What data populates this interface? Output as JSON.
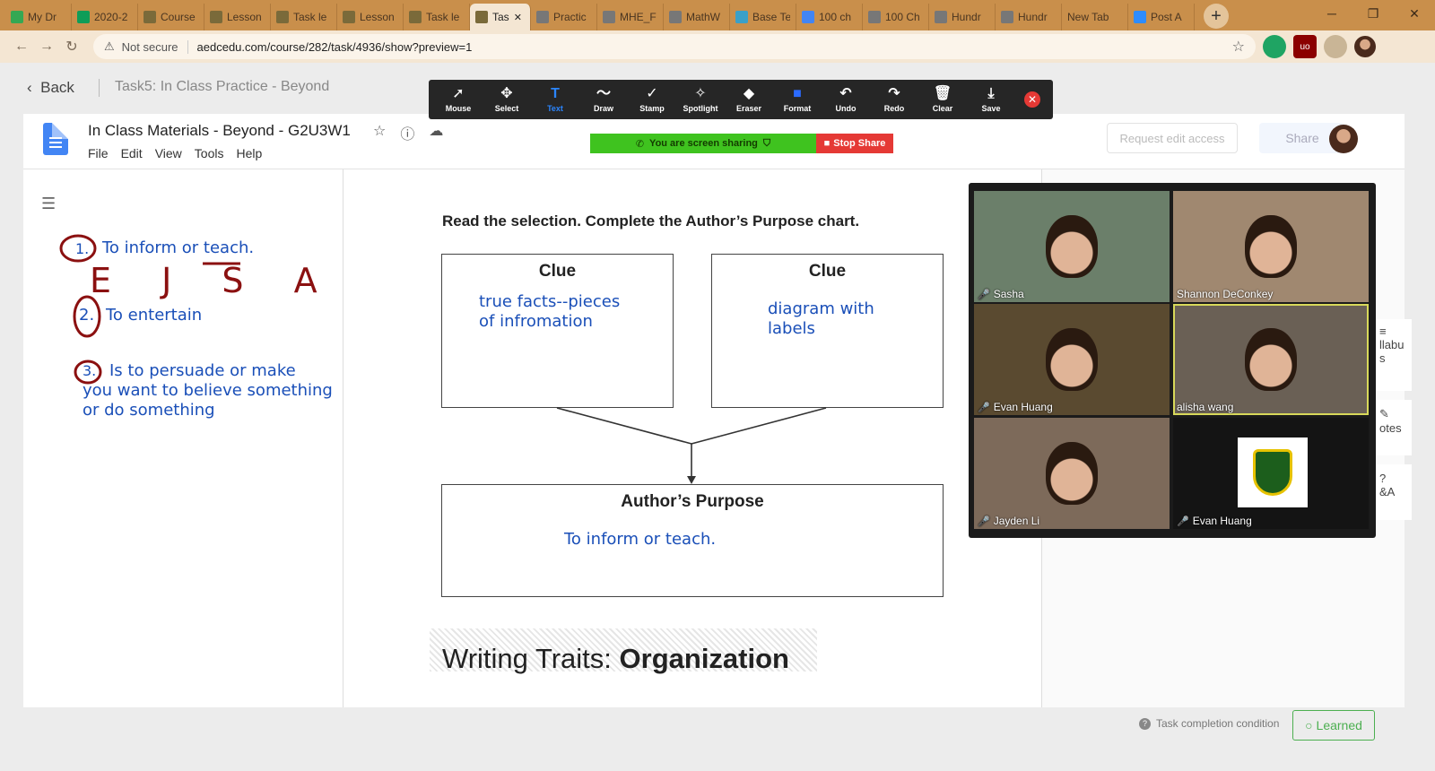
{
  "browser": {
    "tabs": [
      {
        "label": "My Dr",
        "color": "#34a853"
      },
      {
        "label": "2020-2",
        "color": "#0f9d58"
      },
      {
        "label": "Course",
        "color": "#7a6a3a"
      },
      {
        "label": "Lesson",
        "color": "#7a6a3a"
      },
      {
        "label": "Task le",
        "color": "#7a6a3a"
      },
      {
        "label": "Lesson",
        "color": "#7a6a3a"
      },
      {
        "label": "Task le",
        "color": "#7a6a3a"
      },
      {
        "label": "Tas",
        "color": "#7a6a3a",
        "active": true
      },
      {
        "label": "Practic",
        "color": "#777"
      },
      {
        "label": "MHE_F",
        "color": "#777"
      },
      {
        "label": "MathW",
        "color": "#777"
      },
      {
        "label": "Base Te",
        "color": "#3aa0c8"
      },
      {
        "label": "100 ch",
        "color": "#4285f4"
      },
      {
        "label": "100 Ch",
        "color": "#777"
      },
      {
        "label": "Hundr",
        "color": "#777"
      },
      {
        "label": "Hundr",
        "color": "#777"
      },
      {
        "label": "New Tab",
        "color": ""
      },
      {
        "label": "Post A",
        "color": "#2d8cff"
      }
    ],
    "address": {
      "security": "Not secure",
      "url": "aedcedu.com/course/282/task/4936/show?preview=1"
    }
  },
  "page": {
    "back_label": "Back",
    "breadcrumb": "Task5:  In Class Practice - Beyond"
  },
  "annotate_toolbar": {
    "tools": [
      {
        "name": "mouse",
        "label": "Mouse",
        "icon": "➚"
      },
      {
        "name": "select",
        "label": "Select",
        "icon": "✥"
      },
      {
        "name": "text",
        "label": "Text",
        "icon": "T",
        "selected": true
      },
      {
        "name": "draw",
        "label": "Draw",
        "icon": "〜"
      },
      {
        "name": "stamp",
        "label": "Stamp",
        "icon": "✓"
      },
      {
        "name": "spotlight",
        "label": "Spotlight",
        "icon": "✧"
      },
      {
        "name": "eraser",
        "label": "Eraser",
        "icon": "◆"
      },
      {
        "name": "format",
        "label": "Format",
        "icon": "■"
      },
      {
        "name": "undo",
        "label": "Undo",
        "icon": "↶"
      },
      {
        "name": "redo",
        "label": "Redo",
        "icon": "↷"
      },
      {
        "name": "clear",
        "label": "Clear",
        "icon": "🗑"
      },
      {
        "name": "save",
        "label": "Save",
        "icon": "⤓"
      }
    ]
  },
  "doc": {
    "title": "In Class Materials - Beyond - G2U3W1",
    "menu": [
      "File",
      "Edit",
      "View",
      "Tools",
      "Help"
    ],
    "screen_share": {
      "status": "You are screen sharing",
      "stop": "Stop Share"
    },
    "request_edit": "Request edit access",
    "share": "Share",
    "notes": {
      "n1": "To inform or teach.",
      "n1_num": "1.",
      "letters": "E J S A",
      "n2": "To entertain",
      "n2_num": "2.",
      "n3_num": "3.",
      "n3_line1": "Is to persuade or make",
      "n3_line2": "you want to believe something",
      "n3_line3": "or do something"
    },
    "worksheet": {
      "instruction": "Read the selection. Complete the Author’s Purpose chart.",
      "clue1_header": "Clue",
      "clue1_line1": "true facts--pieces",
      "clue1_line2": "of infromation",
      "clue2_header": "Clue",
      "clue2_line1": "diagram with",
      "clue2_line2": "labels",
      "purpose_header": "Author’s Purpose",
      "purpose_answer": "To inform or teach.",
      "traits_prefix": "Writing Traits: ",
      "traits_bold": "Organization"
    }
  },
  "zoom_gallery": {
    "participants": [
      {
        "name": "Sasha",
        "muted": true,
        "bg": "#6b7f6a"
      },
      {
        "name": "Shannon DeConkey",
        "muted": false,
        "bg": "#a08870"
      },
      {
        "name": "Evan Huang",
        "muted": true,
        "bg": "#5a4a30"
      },
      {
        "name": "alisha wang",
        "muted": false,
        "bg": "#6a6055",
        "speaking": true
      },
      {
        "name": "Jayden Li",
        "muted": true,
        "bg": "#7d6a5a"
      },
      {
        "name": "Evan Huang",
        "muted": true,
        "bg": "#141414"
      }
    ]
  },
  "side_fragments": {
    "syllabus": "llabu",
    "syllabus2": "s",
    "notes": "otes",
    "qa": "&A"
  },
  "footer": {
    "condition": "Task completion condition",
    "learned": "Learned"
  }
}
